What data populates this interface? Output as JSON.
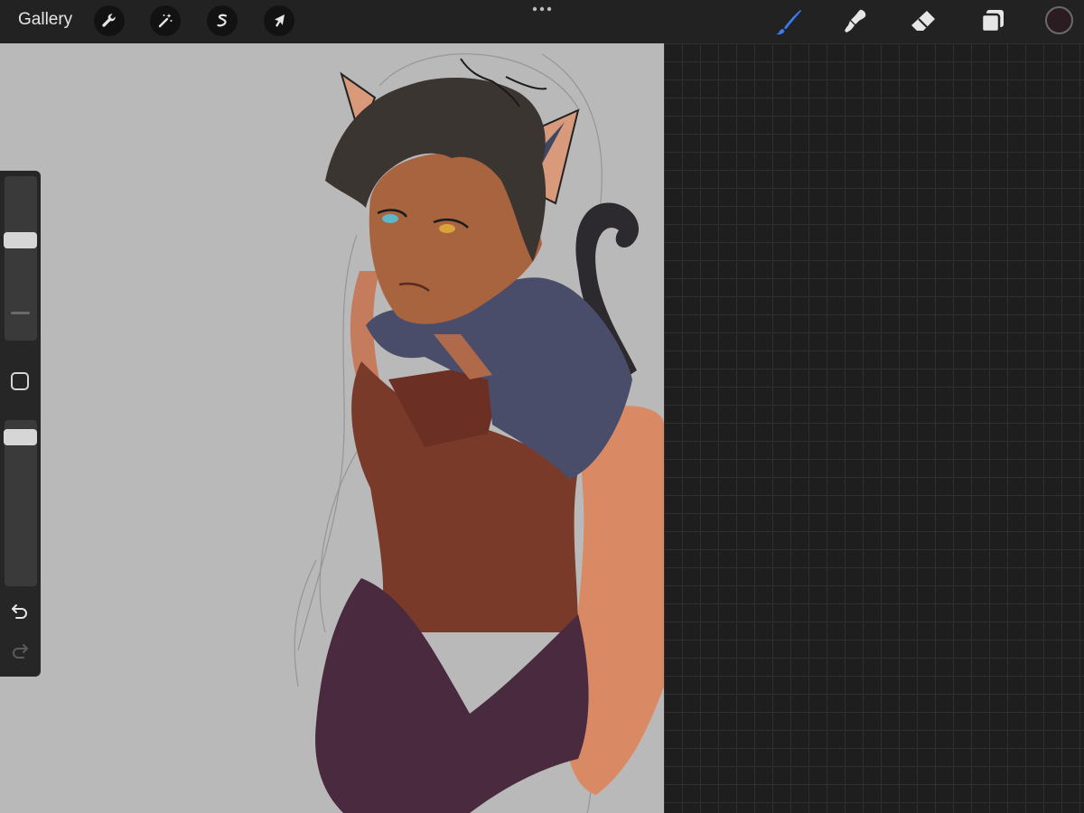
{
  "topbar": {
    "gallery_label": "Gallery",
    "left_tools": [
      {
        "icon": "wrench-icon",
        "name": "actions"
      },
      {
        "icon": "magic-wand-icon",
        "name": "adjustments"
      },
      {
        "icon": "selection-s-icon",
        "name": "selection"
      },
      {
        "icon": "arrow-cursor-icon",
        "name": "transform"
      }
    ],
    "right_tools": [
      {
        "icon": "brush-icon",
        "name": "paint",
        "active": true
      },
      {
        "icon": "smudge-icon",
        "name": "smudge",
        "active": false
      },
      {
        "icon": "eraser-icon",
        "name": "eraser",
        "active": false
      },
      {
        "icon": "layers-icon",
        "name": "layers",
        "active": false
      }
    ],
    "current_color": "#2a1c20",
    "active_color": "#3a7bf2"
  },
  "sidebar": {
    "brush_size_level": 0.62,
    "opacity_level": 0.94
  }
}
